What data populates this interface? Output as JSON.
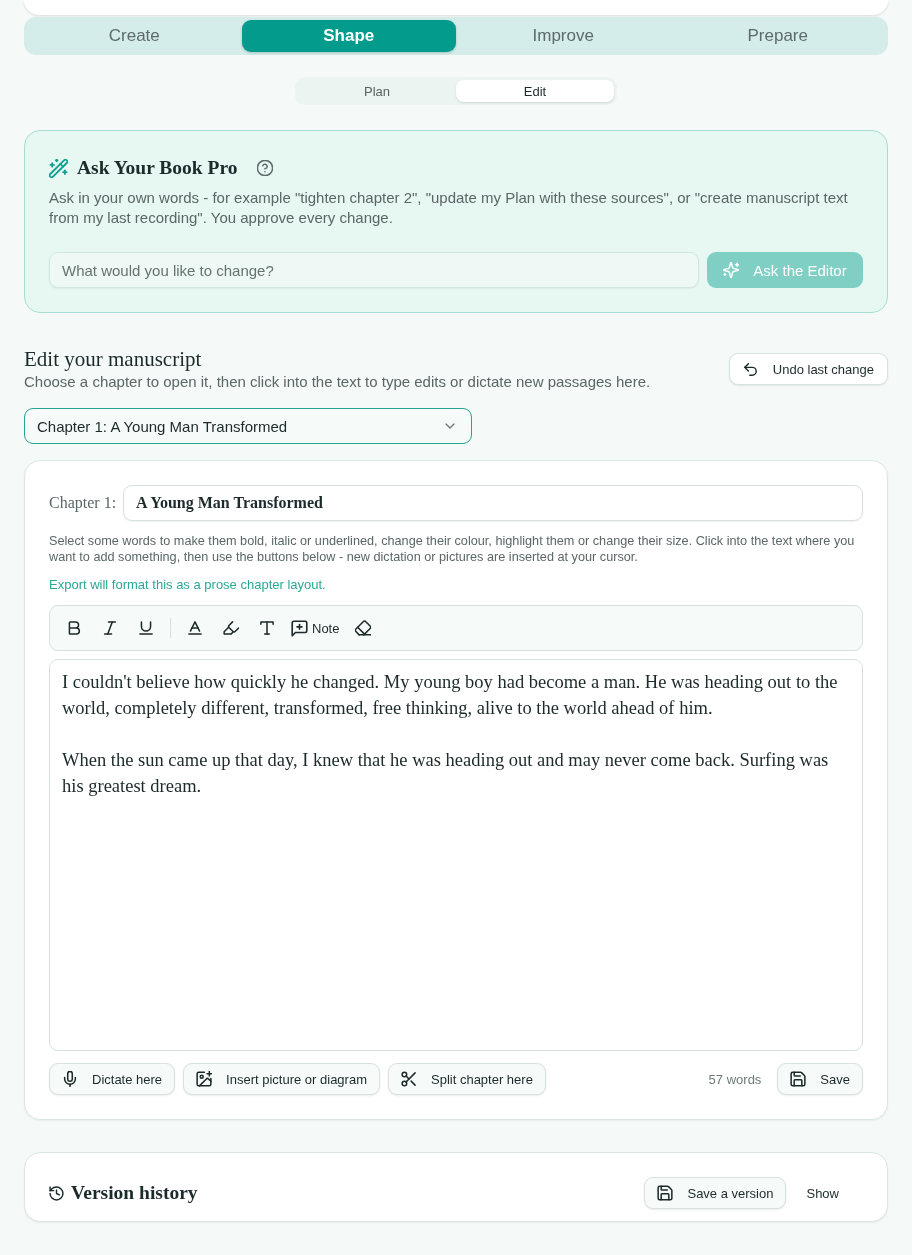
{
  "stage_tabs": [
    {
      "label": "Create",
      "selected": false
    },
    {
      "label": "Shape",
      "selected": true
    },
    {
      "label": "Improve",
      "selected": false
    },
    {
      "label": "Prepare",
      "selected": false
    }
  ],
  "view_toggle": [
    {
      "label": "Plan",
      "selected": false
    },
    {
      "label": "Edit",
      "selected": true
    }
  ],
  "assistant": {
    "title": "Ask Your Book Pro",
    "description": "Ask in your own words - for example \"tighten chapter 2\", \"update my Plan with these sources\", or \"create manuscript text from my last recording\". You approve every change.",
    "input": {
      "placeholder": "What would you like to change?"
    },
    "button": {
      "label": "Ask the Editor",
      "disabled": true
    }
  },
  "manuscript": {
    "title": "Edit your manuscript",
    "subtitle": "Choose a chapter to open it, then click into the text to type edits or dictate new passages here.",
    "undo_button": "Undo last change",
    "chapter_select": {
      "value": "Chapter 1: A Young Man Transformed"
    }
  },
  "editor": {
    "chapter_label": "Chapter 1:",
    "chapter_title": {
      "value": "A Young Man Transformed"
    },
    "help_text": "Select some words to make them bold, italic or underlined, change their colour, highlight them or change their size. Click into the text where you want to add something, then use the buttons below - new dictation or pictures are inserted at your cursor.",
    "export_note": "Export will format this as a prose chapter layout.",
    "toolbar": {
      "note_button": "Note"
    },
    "paragraphs": [
      "I couldn't believe how quickly he changed. My young boy had become a man. He was heading out to the world, completely different, transformed, free thinking, alive to the world ahead of him.",
      "When the sun came up that day, I knew that he was heading out and may never come back. Surfing was his greatest dream."
    ],
    "actions": [
      {
        "label": "Dictate here"
      },
      {
        "label": "Insert picture or diagram"
      },
      {
        "label": "Split chapter here"
      }
    ],
    "word_count": "57 words",
    "save_button": "Save"
  },
  "version_history": {
    "title": "Version history",
    "save_button": "Save a version",
    "show_button": "Show"
  }
}
